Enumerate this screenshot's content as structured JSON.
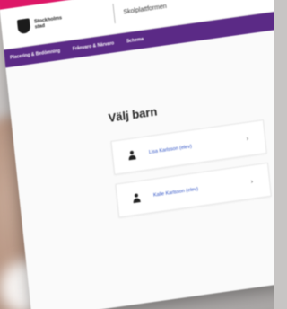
{
  "header": {
    "logo_text": "Stockholms stad",
    "portal_name": "Skolplattformen",
    "accent_color": "#dd1767",
    "nav_color": "#5b2a86"
  },
  "nav": {
    "items": [
      {
        "label": "Placering & Bedömning"
      },
      {
        "label": "Frånvaro & Närvaro"
      },
      {
        "label": "Schema"
      }
    ]
  },
  "main": {
    "title": "Välj barn",
    "children": [
      {
        "name": "Lisa Karlsson (elev)",
        "icon": "person-icon",
        "action_icon": "chevron-right-icon"
      },
      {
        "name": "Kalle Karlsson (elev)",
        "icon": "person-icon",
        "action_icon": "chevron-right-icon"
      }
    ]
  }
}
